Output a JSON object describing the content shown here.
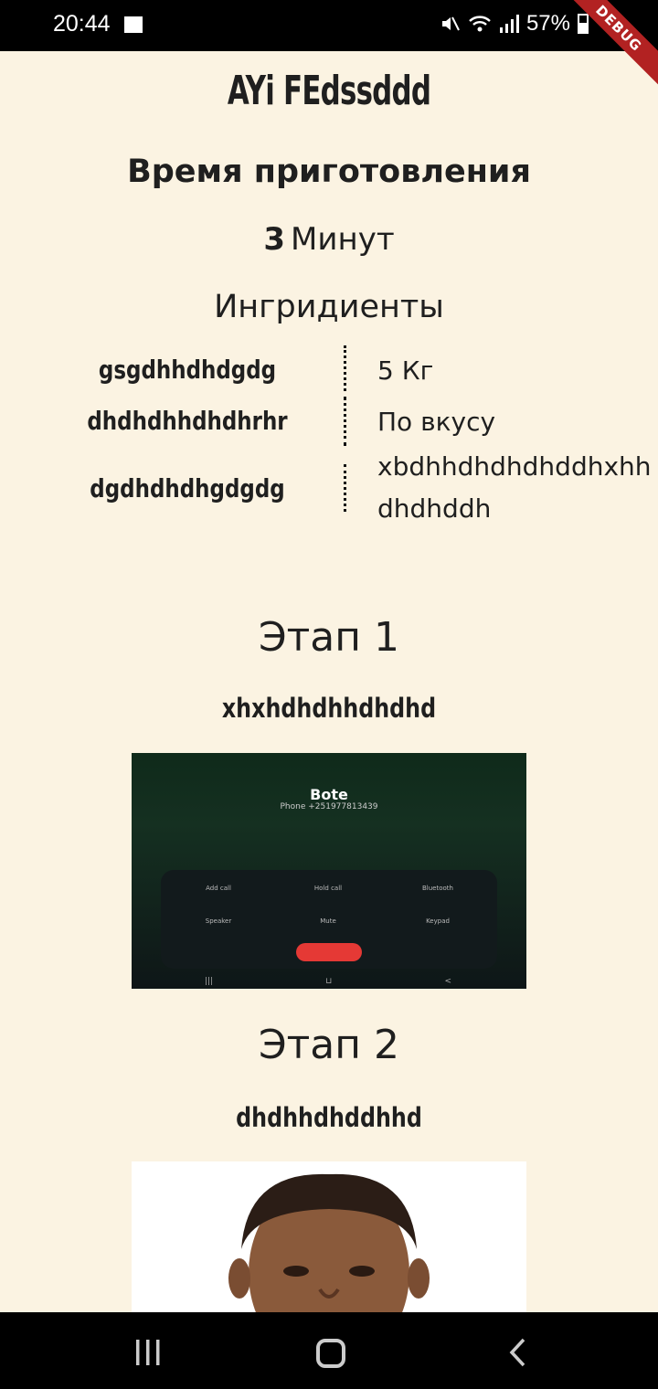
{
  "status_bar": {
    "time": "20:44",
    "battery": "57%"
  },
  "debug_banner": "DEBUG",
  "recipe": {
    "title": "AYi FEdssddd",
    "cook_time_heading": "Время приготовления",
    "cook_time_value": "3",
    "cook_time_unit": "Минут",
    "ingredients_heading": "Ингридиенты",
    "ingredients": [
      {
        "name": "gsgdhhdhdgdg",
        "amount": "5 Кг"
      },
      {
        "name": "dhdhdhhdhdhrhr",
        "amount": "По вкусу"
      },
      {
        "name": "dgdhdhdhgdgdg",
        "amount": "xbdhhdhdhdhddhxhh dhdhddh"
      }
    ],
    "stages": [
      {
        "title": "Этап 1",
        "description": "xhxhdhdhhdhdhd",
        "screenshot": {
          "caller": "Bote",
          "phone": "Phone +251977813439",
          "buttons": [
            "Add call",
            "Hold call",
            "Bluetooth",
            "Speaker",
            "Mute",
            "Keypad"
          ]
        }
      },
      {
        "title": "Этап 2",
        "description": "dhdhhdhddhhd"
      }
    ]
  }
}
